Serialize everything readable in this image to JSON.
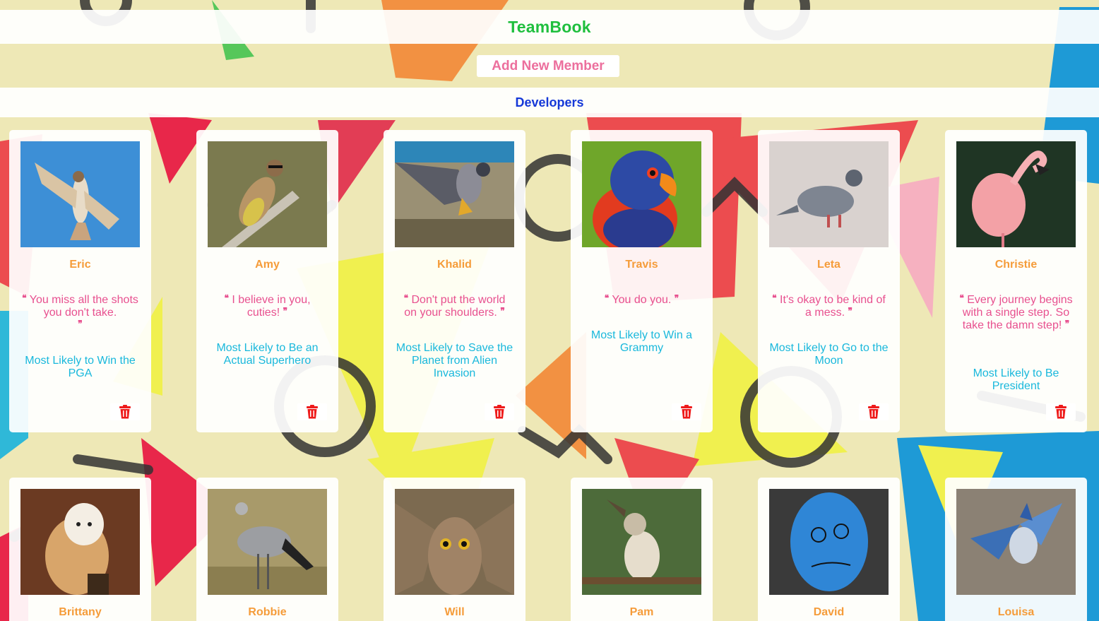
{
  "app": {
    "title": "TeamBook"
  },
  "toolbar": {
    "add_label": "Add New Member"
  },
  "section": {
    "title": "Developers"
  },
  "icons": {
    "delete": "trash-icon",
    "quote_open": "quote-open-icon",
    "quote_close": "quote-close-icon"
  },
  "colors": {
    "title": "#1fbf3e",
    "add_button": "#ec6f9d",
    "section": "#1538d8",
    "name": "#f59c3a",
    "quote": "#e8508f",
    "award": "#19b8dc",
    "delete": "#ee1b1b"
  },
  "members": [
    {
      "name": "Eric",
      "quote": "You miss all the shots you don't take.",
      "award": "Most Likely to Win the PGA",
      "photo": "red-tailed hawk soaring in blue sky"
    },
    {
      "name": "Amy",
      "quote": "I believe in you, cuties!",
      "award": "Most Likely to Be an Actual Superhero",
      "photo": "cedar waxwing on branch"
    },
    {
      "name": "Khalid",
      "quote": "Don't put the world on your shoulders.",
      "award": "Most Likely to Save the Planet from Alien Invasion",
      "photo": "peregrine falcon landing"
    },
    {
      "name": "Travis",
      "quote": "You do you.",
      "award": "Most Likely to Win a Grammy",
      "photo": "rainbow lorikeet"
    },
    {
      "name": "Leta",
      "quote": "It's okay to be kind of a mess.",
      "award": "Most Likely to Go to the Moon",
      "photo": "pigeon on pavement"
    },
    {
      "name": "Christie",
      "quote": "Every journey begins with a single step. So take the damn step!",
      "award": "Most Likely to Be President",
      "photo": "pink flamingo"
    },
    {
      "name": "Brittany",
      "photo": "barn owl"
    },
    {
      "name": "Robbie",
      "photo": "secretary bird"
    },
    {
      "name": "Will",
      "photo": "great horned owl"
    },
    {
      "name": "Pam",
      "photo": "kookaburra"
    },
    {
      "name": "David",
      "photo": "blue balloon with face"
    },
    {
      "name": "Louisa",
      "photo": "blue jay in flight"
    }
  ]
}
